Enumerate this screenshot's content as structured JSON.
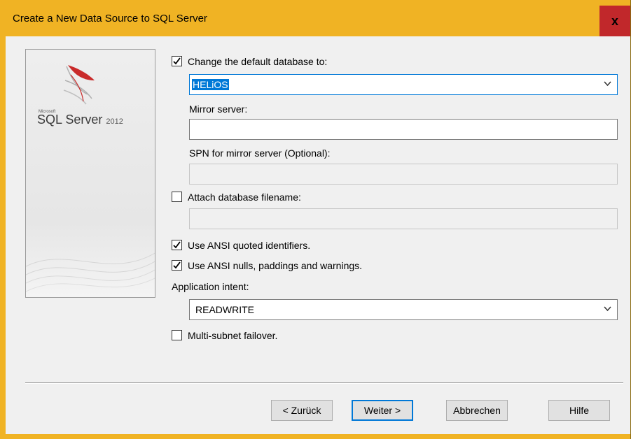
{
  "window": {
    "title": "Create a New Data Source to SQL Server",
    "close_glyph": "x"
  },
  "logo": {
    "brand_small": "Microsoft",
    "product": "SQL Server",
    "version": "2012"
  },
  "form": {
    "change_db": {
      "label": "Change the default database to:",
      "checked": true
    },
    "database_value": "HELiOS",
    "mirror_label": "Mirror server:",
    "mirror_value": "",
    "spn_label": "SPN for mirror server (Optional):",
    "spn_value": "",
    "attach": {
      "label": "Attach database filename:",
      "checked": false
    },
    "attach_value": "",
    "ansi_quoted": {
      "label": "Use ANSI quoted identifiers.",
      "checked": true
    },
    "ansi_nulls": {
      "label": "Use ANSI nulls, paddings and warnings.",
      "checked": true
    },
    "intent_label": "Application intent:",
    "intent_value": "READWRITE",
    "multisubnet": {
      "label": "Multi-subnet failover.",
      "checked": false
    }
  },
  "buttons": {
    "back": "< Zurück",
    "next": "Weiter >",
    "cancel": "Abbrechen",
    "help": "Hilfe"
  },
  "colors": {
    "title_bar": "#f0b324",
    "close": "#c1282b",
    "accent": "#0078d7"
  },
  "icons": [
    "close-icon",
    "checkmark-icon",
    "chevron-down-icon",
    "sql-server-logo"
  ]
}
